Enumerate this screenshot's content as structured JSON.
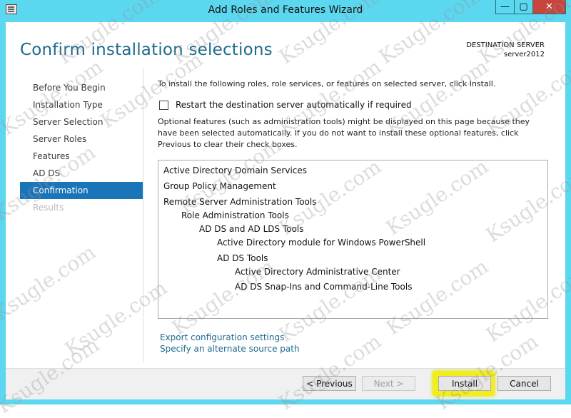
{
  "window": {
    "title": "Add Roles and Features Wizard",
    "minimize_glyph": "—",
    "maximize_glyph": "▢",
    "close_glyph": "✕"
  },
  "header": {
    "page_title": "Confirm installation selections",
    "dest_label": "DESTINATION SERVER",
    "dest_server": "server2012"
  },
  "nav": {
    "items": [
      {
        "label": "Before You Begin"
      },
      {
        "label": "Installation Type"
      },
      {
        "label": "Server Selection"
      },
      {
        "label": "Server Roles"
      },
      {
        "label": "Features"
      },
      {
        "label": "AD DS"
      },
      {
        "label": "Confirmation",
        "active": true
      },
      {
        "label": "Results",
        "disabled": true
      }
    ]
  },
  "content": {
    "intro": "To install the following roles, role services, or features on selected server, click Install.",
    "restart_label": "Restart the destination server automatically if required",
    "optional_text": "Optional features (such as administration tools) might be displayed on this page because they have been selected automatically. If you do not want to install these optional features, click Previous to clear their check boxes.",
    "features": [
      {
        "label": "Active Directory Domain Services",
        "level": 0
      },
      {
        "label": "Group Policy Management",
        "level": 0
      },
      {
        "label": "Remote Server Administration Tools",
        "level": 0
      },
      {
        "label": "Role Administration Tools",
        "level": 1
      },
      {
        "label": "AD DS and AD LDS Tools",
        "level": 2
      },
      {
        "label": "Active Directory module for Windows PowerShell",
        "level": 3
      },
      {
        "label": "AD DS Tools",
        "level": 3
      },
      {
        "label": "Active Directory Administrative Center",
        "level": 4
      },
      {
        "label": "AD DS Snap-Ins and Command-Line Tools",
        "level": 4
      }
    ],
    "link_export": "Export configuration settings",
    "link_alternate": "Specify an alternate source path"
  },
  "footer": {
    "previous": "< Previous",
    "next": "Next >",
    "install": "Install",
    "cancel": "Cancel"
  },
  "watermark": "Ksugle.com",
  "colors": {
    "accent": "#1a75b8",
    "title_blue": "#1e6a8c",
    "frame": "#5bd7f0",
    "close": "#c7453c",
    "highlight": "#f2ee1d"
  }
}
